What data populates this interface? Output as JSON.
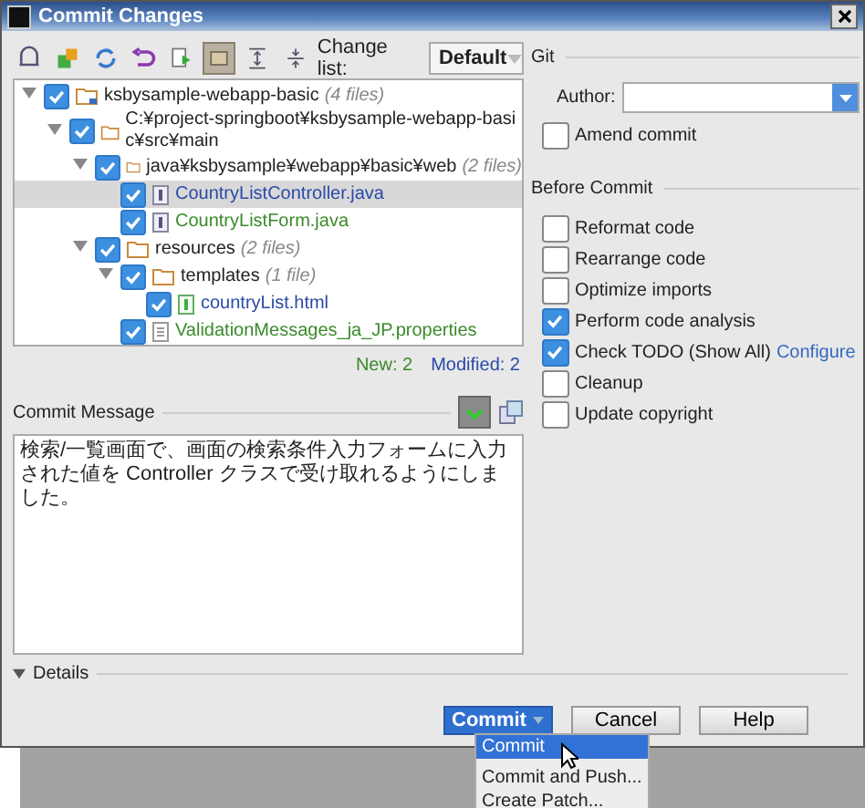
{
  "window": {
    "title": "Commit Changes"
  },
  "toolbar": [
    {
      "selected": false
    },
    {
      "selected": false
    },
    {
      "selected": false
    },
    {
      "selected": false
    },
    {
      "selected": false
    },
    {
      "selected": true
    },
    {
      "selected": false
    },
    {
      "selected": false
    }
  ],
  "change_list": {
    "label": "Change list:",
    "value": "Default"
  },
  "tree": [
    {
      "kind": "module",
      "label": "ksbysample-webapp-basic",
      "count": "(4 files)",
      "checked": true,
      "expanded": true,
      "selected": false,
      "children": [
        {
          "kind": "folder",
          "label": "C:¥project-springboot¥ksbysample-webapp-basic¥src¥main",
          "checked": true,
          "expanded": true,
          "selected": false,
          "children": [
            {
              "kind": "folder",
              "label": "java¥ksbysample¥webapp¥basic¥web",
              "count": "(2 files)",
              "checked": true,
              "expanded": true,
              "selected": false,
              "children": [
                {
                  "kind": "java",
                  "label": "CountryListController.java",
                  "color": "#2a4aa8",
                  "checked": true,
                  "selected": true
                },
                {
                  "kind": "java",
                  "label": "CountryListForm.java",
                  "color": "#3a8a2a",
                  "checked": true,
                  "selected": false
                }
              ]
            },
            {
              "kind": "folder",
              "label": "resources",
              "count": "(2 files)",
              "checked": true,
              "expanded": true,
              "selected": false,
              "children": [
                {
                  "kind": "folder",
                  "label": "templates",
                  "count": "(1 file)",
                  "checked": true,
                  "expanded": true,
                  "selected": false,
                  "children": [
                    {
                      "kind": "html",
                      "label": "countryList.html",
                      "color": "#2a4aa8",
                      "checked": true,
                      "selected": false
                    }
                  ]
                },
                {
                  "kind": "properties",
                  "label": "ValidationMessages_ja_JP.properties",
                  "color": "#3a8a2a",
                  "checked": true,
                  "selected": false
                }
              ]
            }
          ]
        }
      ]
    }
  ],
  "status": {
    "new": "New: 2",
    "modified": "Modified: 2"
  },
  "commit_message": {
    "label": "Commit Message",
    "spellcheck_selected": true,
    "value": "検索/一覧画面で、画面の検索条件入力フォームに入力された値を Controller クラスで受け取れるようにしました。"
  },
  "details": {
    "label": "Details",
    "expanded": true
  },
  "git": {
    "title": "Git",
    "author_label": "Author:",
    "amend": {
      "label": "Amend commit",
      "checked": false
    }
  },
  "before_commit": {
    "title": "Before Commit",
    "options": [
      {
        "label": "Reformat code",
        "checked": false
      },
      {
        "label": "Rearrange code",
        "checked": false
      },
      {
        "label": "Optimize imports",
        "checked": false
      },
      {
        "label": "Perform code analysis",
        "checked": true
      },
      {
        "label": "Check TODO (Show All)",
        "checked": true,
        "link": "Configure"
      },
      {
        "label": "Cleanup",
        "checked": false
      },
      {
        "label": "Update copyright",
        "checked": false
      }
    ]
  },
  "buttons": [
    {
      "kind": "split",
      "label": "Commit"
    },
    {
      "kind": "plain",
      "label": "Cancel"
    },
    {
      "kind": "plain",
      "label": "Help"
    }
  ],
  "commit_menu": [
    {
      "label": "Commit",
      "selected": true
    },
    {
      "label": "Commit and Push...",
      "selected": false
    },
    {
      "label": "Create Patch...",
      "selected": false
    }
  ]
}
